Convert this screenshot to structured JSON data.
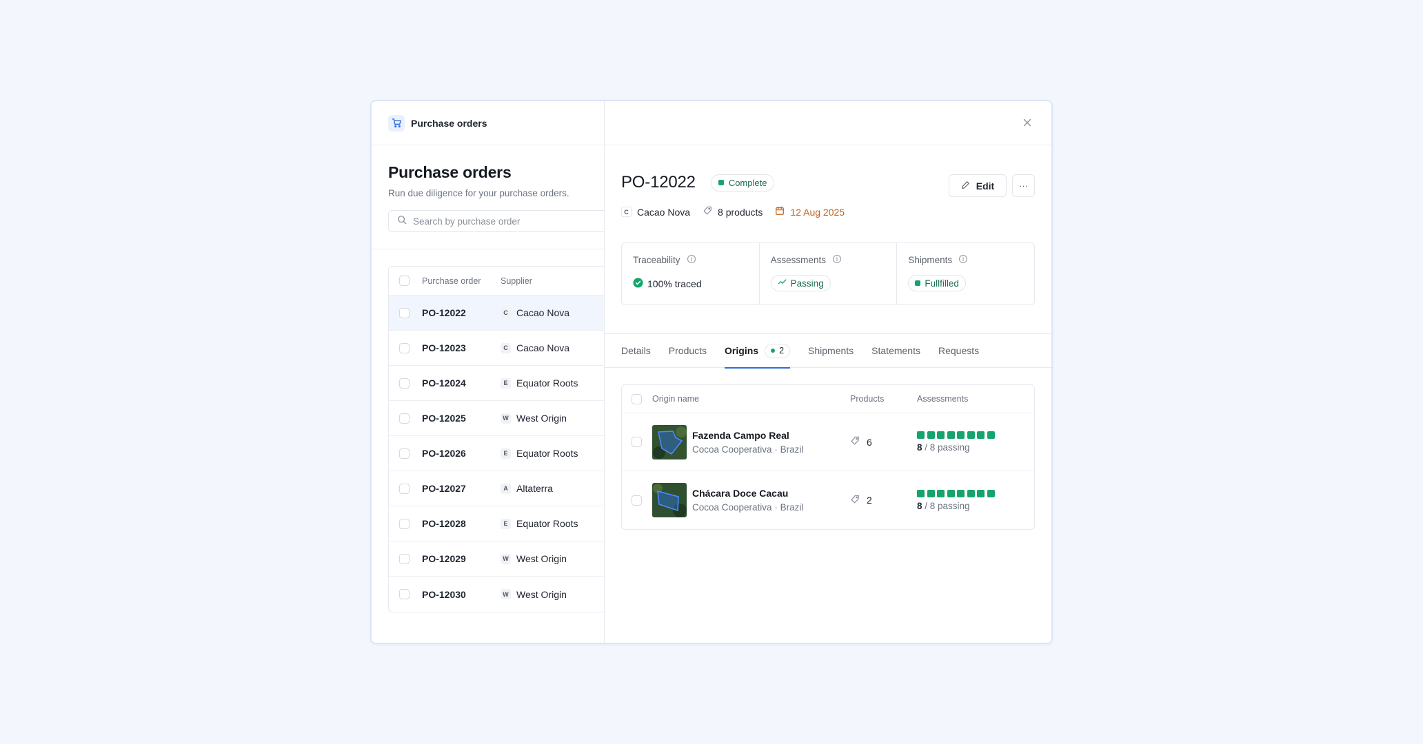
{
  "app": {
    "title": "Purchase orders"
  },
  "list": {
    "title": "Purchase orders",
    "subtitle": "Run due diligence for your purchase orders.",
    "search_placeholder": "Search by purchase order",
    "columns": {
      "po": "Purchase order",
      "supplier": "Supplier"
    },
    "rows": [
      {
        "po": "PO-12022",
        "initial": "C",
        "supplier": "Cacao Nova"
      },
      {
        "po": "PO-12023",
        "initial": "C",
        "supplier": "Cacao Nova"
      },
      {
        "po": "PO-12024",
        "initial": "E",
        "supplier": "Equator Roots"
      },
      {
        "po": "PO-12025",
        "initial": "W",
        "supplier": "West Origin"
      },
      {
        "po": "PO-12026",
        "initial": "E",
        "supplier": "Equator Roots"
      },
      {
        "po": "PO-12027",
        "initial": "A",
        "supplier": "Altaterra"
      },
      {
        "po": "PO-12028",
        "initial": "E",
        "supplier": "Equator Roots"
      },
      {
        "po": "PO-12029",
        "initial": "W",
        "supplier": "West Origin"
      },
      {
        "po": "PO-12030",
        "initial": "W",
        "supplier": "West Origin"
      }
    ]
  },
  "detail": {
    "po": "PO-12022",
    "status": "Complete",
    "edit_label": "Edit",
    "more_label": "···",
    "supplier_initial": "C",
    "supplier": "Cacao Nova",
    "products": "8 products",
    "date": "12 Aug 2025",
    "stats": {
      "traceability": {
        "label": "Traceability",
        "value": "100% traced"
      },
      "assessments": {
        "label": "Assessments",
        "value": "Passing"
      },
      "shipments": {
        "label": "Shipments",
        "value": "Fullfilled"
      }
    },
    "tabs": {
      "details": "Details",
      "products": "Products",
      "origins": "Origins",
      "origins_count": "2",
      "shipments": "Shipments",
      "statements": "Statements",
      "requests": "Requests"
    },
    "origins": {
      "columns": {
        "name": "Origin name",
        "products": "Products",
        "assessments": "Assessments"
      },
      "rows": [
        {
          "name": "Fazenda Campo Real",
          "sub": "Cocoa Cooperativa · Brazil",
          "products": "6",
          "passing": "8",
          "total": " / 8 passing"
        },
        {
          "name": "Chácara Doce Cacau",
          "sub": "Cocoa Cooperativa · Brazil",
          "products": "2",
          "passing": "8",
          "total": " / 8 passing"
        }
      ]
    }
  },
  "colors": {
    "accent": "#2d6cdf",
    "success": "#15a46e",
    "date": "#c2601a"
  },
  "icons": [
    "cart-icon",
    "search-icon",
    "close-icon",
    "pencil-icon",
    "tag-icon",
    "calendar-icon",
    "info-icon",
    "check-circle-icon",
    "trend-icon"
  ]
}
